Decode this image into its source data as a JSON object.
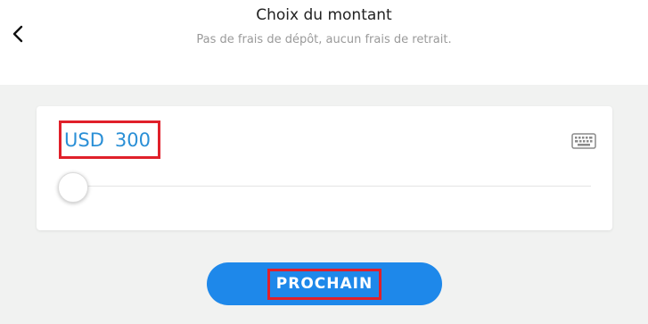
{
  "header": {
    "title": "Choix du montant",
    "subtitle": "Pas de frais de dépôt, aucun frais de retrait."
  },
  "amount": {
    "currency": "USD",
    "value": "300",
    "slider_fraction": 0.0
  },
  "actions": {
    "next_label": "PROCHAIN"
  },
  "colors": {
    "accent": "#1e88ea",
    "amount_text": "#2a8fd6",
    "highlight": "#e0202a",
    "background": "#f1f2f1"
  },
  "icons": {
    "back": "chevron-left-icon",
    "keyboard": "keyboard-icon"
  }
}
